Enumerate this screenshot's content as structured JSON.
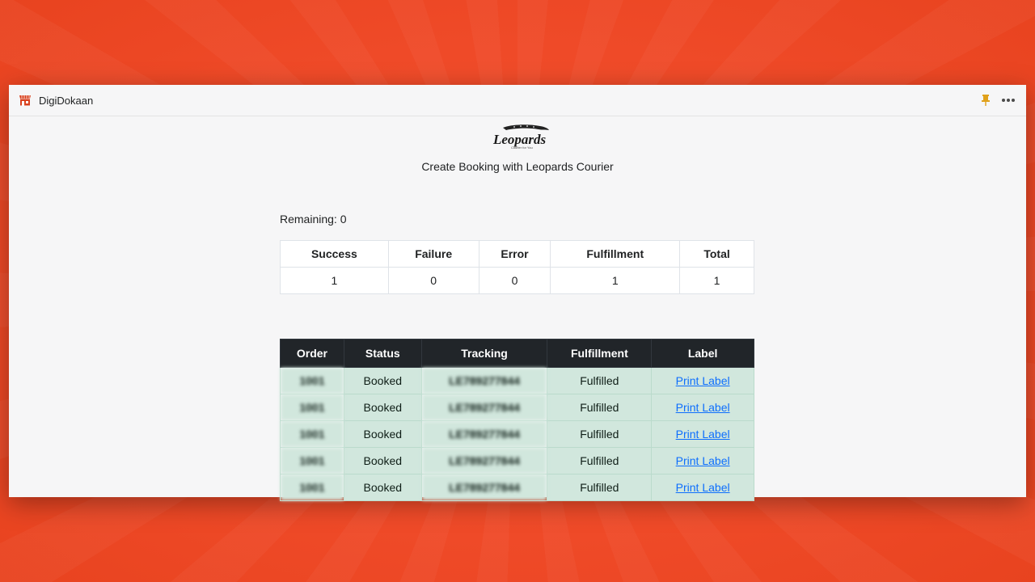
{
  "window": {
    "app_name": "DigiDokaan",
    "icons": [
      "store-icon",
      "pin-icon",
      "more-icon"
    ],
    "accent": "#d9411e",
    "pin_color": "#e0a11b"
  },
  "header": {
    "logo_text": "Leopards",
    "logo_tagline": "Courier for You",
    "title": "Create Booking with Leopards Courier"
  },
  "remaining_text": "Remaining: 0",
  "summary": {
    "columns": [
      "Success",
      "Failure",
      "Error",
      "Fulfillment",
      "Total"
    ],
    "values": [
      "1",
      "0",
      "0",
      "1",
      "1"
    ]
  },
  "orders": {
    "columns": [
      "Order",
      "Status",
      "Tracking",
      "Fulfillment",
      "Label"
    ],
    "rows": [
      {
        "order": "1001",
        "status": "Booked",
        "tracking": "LE789277844",
        "fulfillment": "Fulfilled",
        "label": "Print Label"
      },
      {
        "order": "1001",
        "status": "Booked",
        "tracking": "LE789277844",
        "fulfillment": "Fulfilled",
        "label": "Print Label"
      },
      {
        "order": "1001",
        "status": "Booked",
        "tracking": "LE789277844",
        "fulfillment": "Fulfilled",
        "label": "Print Label"
      },
      {
        "order": "1001",
        "status": "Booked",
        "tracking": "LE789277844",
        "fulfillment": "Fulfilled",
        "label": "Print Label"
      },
      {
        "order": "1001",
        "status": "Booked",
        "tracking": "LE789277844",
        "fulfillment": "Fulfilled",
        "label": "Print Label"
      }
    ]
  },
  "colors": {
    "background": "#ef4a28",
    "table_header": "#212529",
    "row_success": "#d1e7dd",
    "link": "#0d6efd"
  }
}
